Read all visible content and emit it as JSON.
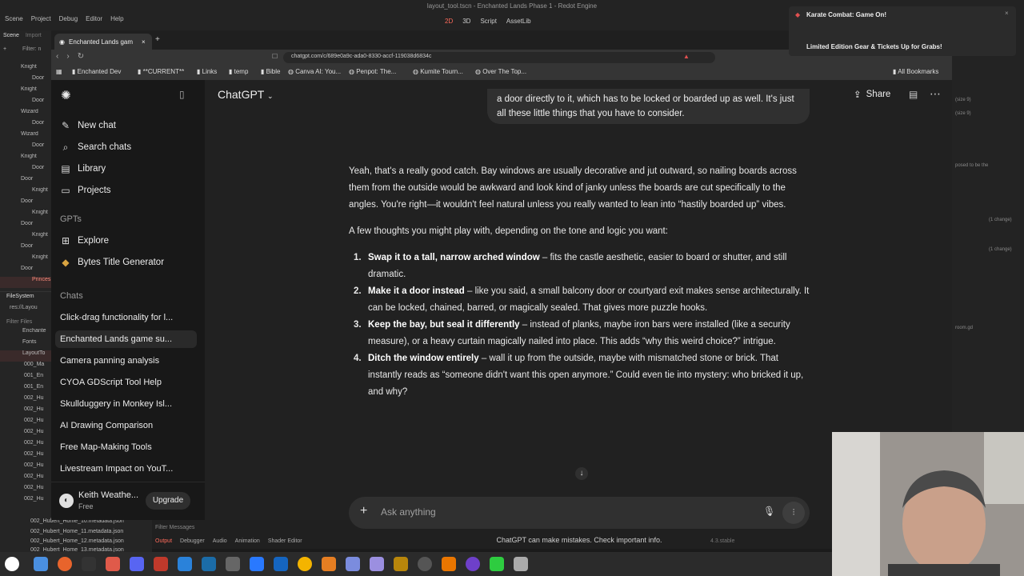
{
  "godot": {
    "title": "layout_tool.tscn - Enchanted Lands Phase 1 - Redot Engine",
    "menu": [
      "Scene",
      "Project",
      "Debug",
      "Editor",
      "Help"
    ],
    "modes": [
      "2D",
      "3D",
      "Script",
      "AssetLib"
    ],
    "left_tabs": [
      "Scene",
      "Import"
    ],
    "filter_label": "Filter: n",
    "tree_items": [
      "Knight",
      "Door",
      "Knight",
      "Door",
      "Wizard",
      "Door",
      "Wizard",
      "Door",
      "Knight",
      "Door",
      "Door",
      "Knight",
      "Door",
      "Knight",
      "Door",
      "Knight",
      "Door",
      "Knight",
      "Door",
      "Princes"
    ],
    "filesystem_label": "FileSystem",
    "fs_path": "res://Layou",
    "fs_filter": "Filter Files",
    "fs_items": [
      "Enchante",
      "Fonts",
      "LayoutTo",
      "000_Ma",
      "001_En",
      "001_En",
      "002_Hu",
      "002_Hu",
      "002_Hu",
      "002_Hu",
      "002_Hu",
      "002_Hu",
      "002_Hu",
      "002_Hu",
      "002_Hu",
      "002_Hu"
    ],
    "fs_files_bottom": [
      "002_Hubert_Home_10.metadata.json",
      "002_Hubert_Home_11.metadata.json",
      "002_Hubert_Home_12.metadata.json",
      "002_Hubert_Home_13.metadata.json"
    ],
    "bottom_filter": "Filter Messages",
    "bottom_tabs": [
      "Output",
      "Debugger",
      "Audio",
      "Animation",
      "Shader Editor"
    ],
    "version": "4.3.stable",
    "right_texts": [
      "(size 9)",
      "(size 9)",
      "posed to be the",
      "(1 change)",
      "(1 change)",
      "room.gd"
    ]
  },
  "notification": {
    "title": "Karate Combat: Game On!",
    "body": "Limited Edition Gear & Tickets Up for Grabs!"
  },
  "browser": {
    "tab_title": "Enchanted Lands gam",
    "url": "chatgpt.com/c/689e0a9c-ada0-8330-accf-119038d6834c",
    "bookmarks": [
      "Enchanted Dev",
      "**CURRENT**",
      "Links",
      "temp",
      "Bible",
      "Canva AI: You...",
      "Penpot: The...",
      "Kumite Tourn...",
      "Over The Top..."
    ],
    "all_bookmarks": "All Bookmarks"
  },
  "sidebar": {
    "top_items": [
      {
        "label": "New chat",
        "icon": "edit-icon"
      },
      {
        "label": "Search chats",
        "icon": "search-icon"
      },
      {
        "label": "Library",
        "icon": "library-icon"
      },
      {
        "label": "Projects",
        "icon": "folder-icon"
      }
    ],
    "gpts_label": "GPTs",
    "gpt_items": [
      {
        "label": "Explore",
        "icon": "grid-icon"
      },
      {
        "label": "Bytes Title Generator",
        "icon": "bot-icon"
      }
    ],
    "chats_label": "Chats",
    "chats": [
      "Click-drag functionality for l...",
      "Enchanted Lands game su...",
      "Camera panning analysis",
      "CYOA GDScript Tool Help",
      "Skullduggery in Monkey Isl...",
      "AI Drawing Comparison",
      "Free Map-Making Tools",
      "Livestream Impact on YouT..."
    ],
    "active_chat_index": 1,
    "user_name": "Keith Weathe...",
    "user_plan": "Free",
    "upgrade_label": "Upgrade"
  },
  "main": {
    "model_label": "ChatGPT",
    "share_label": "Share",
    "user_message": "a door directly to it, which has to be locked or boarded up as well. It's just all these little things that you have to consider.",
    "para1": "Yeah, that's a really good catch. Bay windows are usually decorative and jut outward, so nailing boards across them from the outside would be awkward and look kind of janky unless the boards are cut specifically to the angles. You're right—it wouldn't feel natural unless you really wanted to lean into “hastily boarded up” vibes.",
    "para2": "A few thoughts you might play with, depending on the tone and logic you want:",
    "list": [
      {
        "num": "1.",
        "bold": "Swap it to a tall, narrow arched window",
        "text": " – fits the castle aesthetic, easier to board or shutter, and still dramatic."
      },
      {
        "num": "2.",
        "bold": "Make it a door instead",
        "text": " – like you said, a small balcony door or courtyard exit makes sense architecturally. It can be locked, chained, barred, or magically sealed. That gives more puzzle hooks."
      },
      {
        "num": "3.",
        "bold": "Keep the bay, but seal it differently",
        "text": " – instead of planks, maybe iron bars were installed (like a security measure), or a heavy curtain magically nailed into place. This adds “why this weird choice?” intrigue."
      },
      {
        "num": "4.",
        "bold": "Ditch the window entirely",
        "text": " – wall it up from the outside, maybe with mismatched stone or brick. That instantly reads as “someone didn't want this open anymore.” Could even tie into mystery: who bricked it up, and why?"
      }
    ],
    "composer_placeholder": "Ask anything",
    "disclaimer": "ChatGPT can make mistakes. Check important info."
  }
}
